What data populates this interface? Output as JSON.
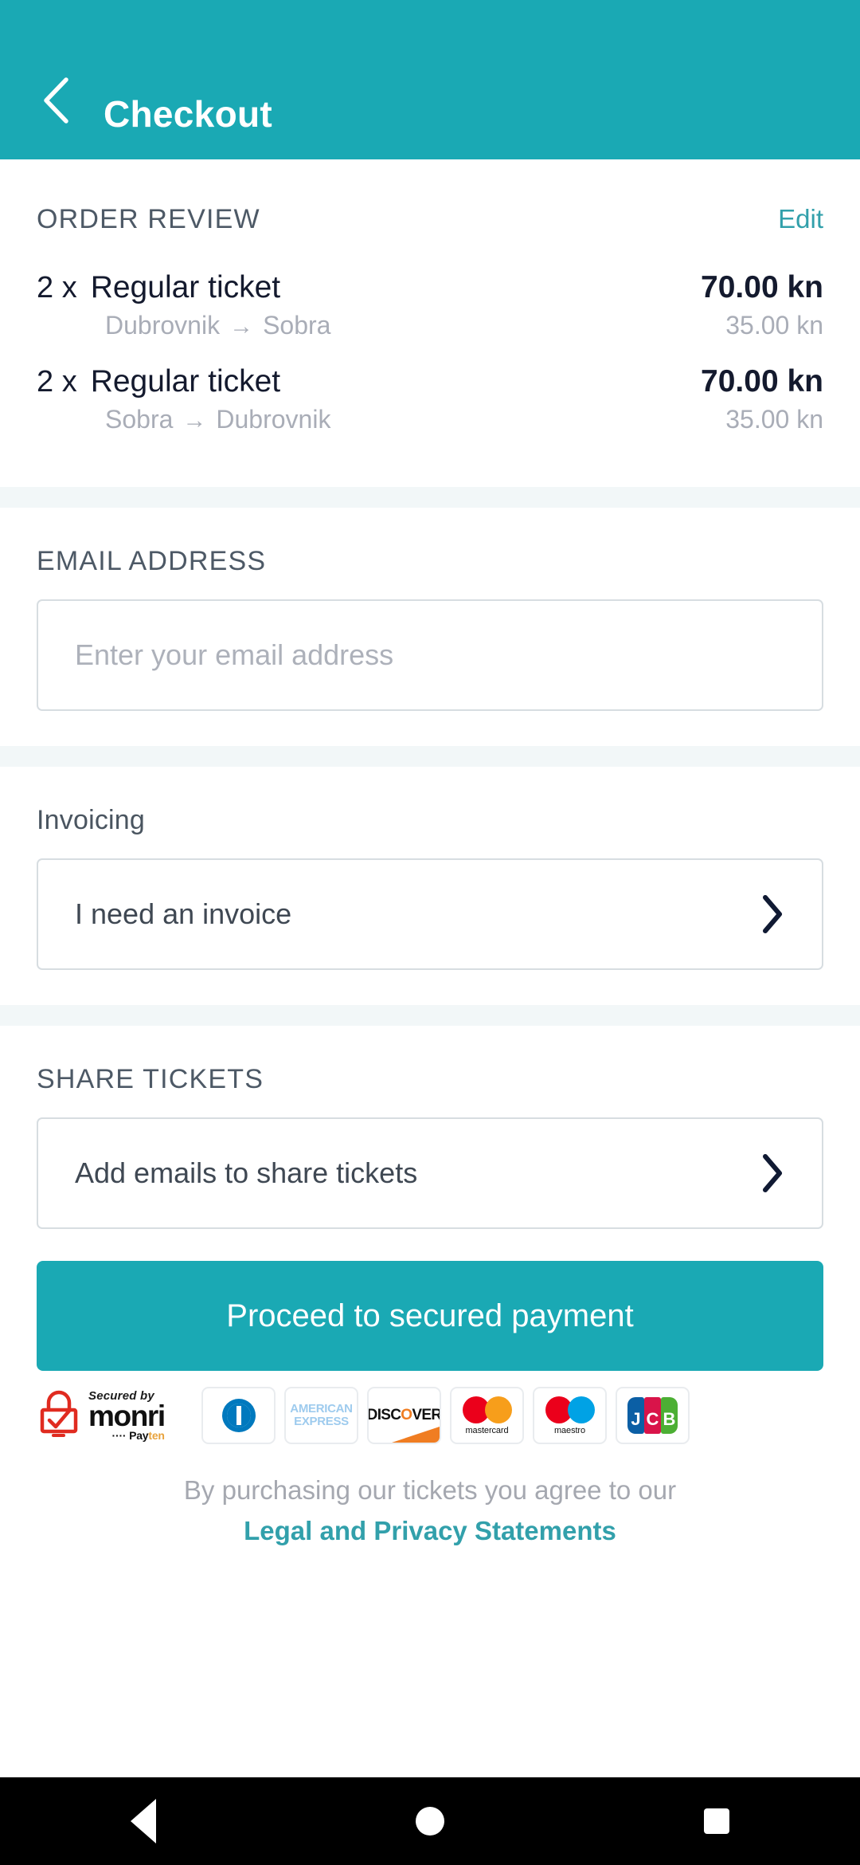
{
  "header": {
    "title": "Checkout",
    "back_icon": "chevron-left-icon",
    "background_color": "#1aa9b4"
  },
  "order_review": {
    "title": "ORDER REVIEW",
    "edit_label": "Edit",
    "items": [
      {
        "quantity": "2 x",
        "name": "Regular ticket",
        "origin": "Dubrovnik",
        "arrow": "→",
        "destination": "Sobra",
        "total_price": "70.00 kn",
        "unit_price": "35.00 kn"
      },
      {
        "quantity": "2 x",
        "name": "Regular ticket",
        "origin": "Sobra",
        "arrow": "→",
        "destination": "Dubrovnik",
        "total_price": "70.00 kn",
        "unit_price": "35.00 kn"
      }
    ]
  },
  "email": {
    "title": "EMAIL ADDRESS",
    "value": "",
    "placeholder": "Enter your email address"
  },
  "invoicing": {
    "title": "Invoicing",
    "option_label": "I need an invoice",
    "chevron_icon": "chevron-right-icon"
  },
  "share_tickets": {
    "title": "SHARE TICKETS",
    "option_label": "Add emails to share tickets",
    "chevron_icon": "chevron-right-icon"
  },
  "cta": {
    "label": "Proceed to secured payment",
    "color": "#1aa9b4"
  },
  "payment_methods": {
    "monri": {
      "secured_by": "Secured by",
      "brand": "monri",
      "partner_prefix": "Pay",
      "partner_suffix": "ten",
      "lock_icon": "padlock-check-icon"
    },
    "cards": [
      {
        "name": "diners-club",
        "label": ""
      },
      {
        "name": "american-express",
        "line1": "AMERICAN",
        "line2": "EXPRESS"
      },
      {
        "name": "discover",
        "label": "DISCOVER"
      },
      {
        "name": "mastercard",
        "label": "mastercard"
      },
      {
        "name": "maestro",
        "label": "maestro"
      },
      {
        "name": "jcb",
        "l1": "J",
        "l2": "C",
        "l3": "B"
      }
    ]
  },
  "legal": {
    "text": "By purchasing our tickets you agree to our",
    "link": "Legal and Privacy Statements",
    "link_color": "#32a0ab"
  },
  "android_nav": {
    "back": "back-triangle-icon",
    "home": "home-circle-icon",
    "recents": "recents-square-icon"
  }
}
